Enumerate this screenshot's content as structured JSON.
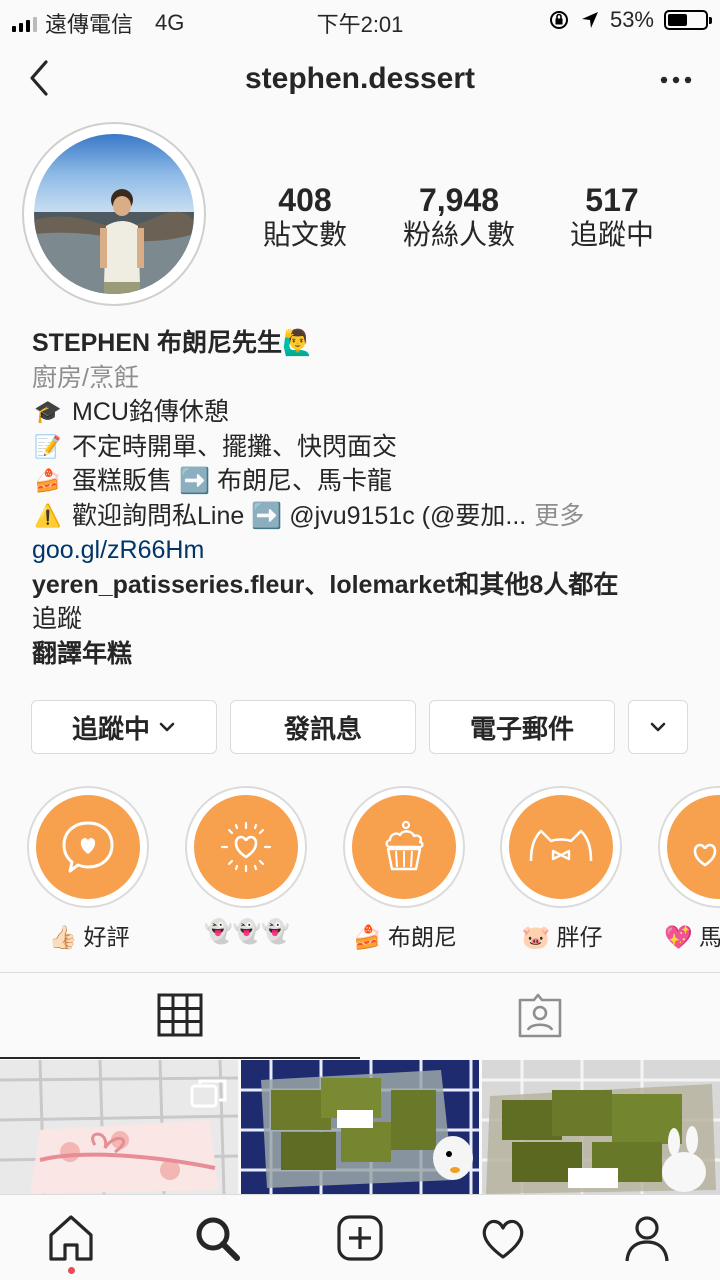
{
  "status_bar": {
    "carrier": "遠傳電信",
    "network": "4G",
    "time": "下午2:01",
    "battery": "53%",
    "battery_level": 0.53
  },
  "nav": {
    "title": "stephen.dessert",
    "back_icon": "chevron-left-icon",
    "more_icon": "more-horizontal-icon"
  },
  "stats": [
    {
      "value": "408",
      "label": "貼文數"
    },
    {
      "value": "7,948",
      "label": "粉絲人數"
    },
    {
      "value": "517",
      "label": "追蹤中"
    }
  ],
  "bio": {
    "name": "STEPHEN 布朗尼先生🙋‍♂️",
    "category": "廚房/烹飪",
    "lines": [
      {
        "icon": "🎓",
        "text": "MCU銘傳休憩"
      },
      {
        "icon": "📝",
        "text": "不定時開單、擺攤、快閃面交"
      },
      {
        "icon": "🍰",
        "text": "蛋糕販售 ➡️ 布朗尼、馬卡龍"
      },
      {
        "icon": "⚠️",
        "text": "歡迎詢問私Line ➡️ @jvu9151c (@要加..."
      }
    ],
    "more_label": "更多",
    "link": "goo.gl/zR66Hm",
    "followed_by_line1": "yeren_patisseries.fleur、lolemarket和其他8人都在",
    "followed_by_line2": "追蹤",
    "translate": "翻譯年糕"
  },
  "buttons": {
    "following": "追蹤中",
    "message": "發訊息",
    "email": "電子郵件"
  },
  "highlights": [
    {
      "label": "👍🏻 好評",
      "icon": "heart-bubble-icon"
    },
    {
      "label": "👻👻👻",
      "icon": "heart-sparkle-icon"
    },
    {
      "label": "🍰 布朗尼",
      "icon": "cupcake-icon"
    },
    {
      "label": "🐷 胖仔",
      "icon": "cat-ears-icon"
    },
    {
      "label": "💖 馬",
      "icon": "hearts-icon"
    }
  ],
  "colors": {
    "highlight_bg": "#f7a04d",
    "link": "#003569",
    "notification_dot": "#ed4956",
    "secondary_text": "#8e8e8e"
  }
}
